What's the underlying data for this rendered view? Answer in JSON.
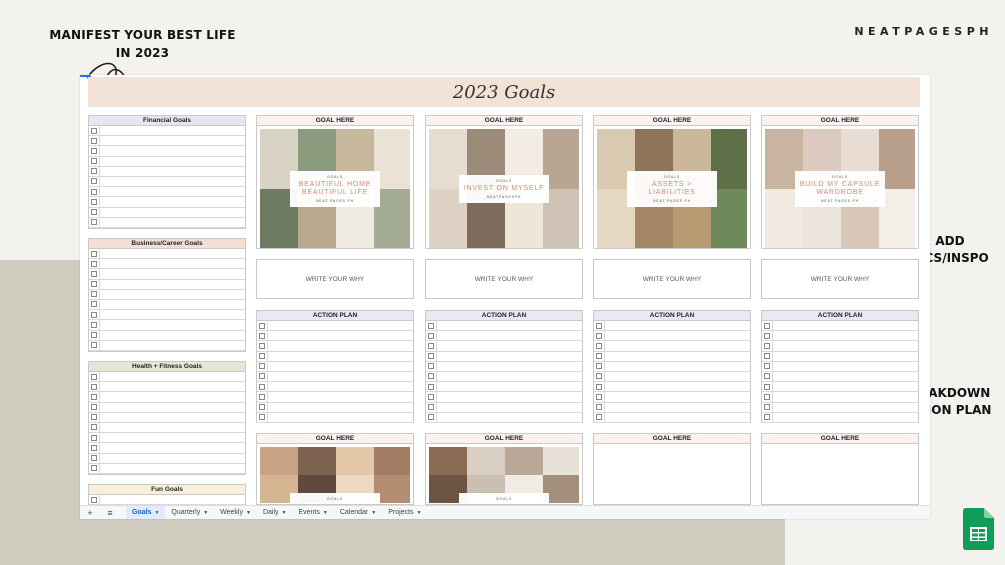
{
  "page": {
    "headline": "MANIFEST YOUR BEST LIFE IN 2023",
    "brand": "NEATPAGESPH",
    "add_pics_label": "ADD PICS/INSPO",
    "breakdown_label": "BREAKDOWN ACTION PLAN"
  },
  "sheet": {
    "title": "2023 Goals",
    "left_lists": [
      {
        "title": "Financial Goals",
        "color": "#e8e4f2"
      },
      {
        "title": "Business/Career Goals",
        "color": "#f3e0d4"
      },
      {
        "title": "Health + Fitness Goals",
        "color": "#e3e7d3"
      },
      {
        "title": "Fun Goals",
        "color": "#f7efd9"
      }
    ],
    "goal_header": "GOAL HERE",
    "why_text": "WRITE YOUR WHY",
    "action_plan_header": "ACTION PLAN",
    "goal_cards": [
      {
        "small": "GOALS",
        "title": "BEAUTIFUL HOME BEAUTIFUL LIFE",
        "credit": "NEAT PAGES PH"
      },
      {
        "small": "GOALS",
        "title": "INVEST ON MYSELF",
        "credit": "NEATPAGESPH"
      },
      {
        "small": "GOALS",
        "title": "ASSETS > LIABILITIES",
        "credit": "NEAT PAGES PH"
      },
      {
        "small": "GOALS",
        "title": "BUILD MY CAPSULE WARDROBE",
        "credit": "NEAT PAGES PH"
      }
    ],
    "bottom_cards": [
      {
        "small": "GOALS"
      },
      {
        "small": "GOALS"
      }
    ],
    "tabs": [
      {
        "label": "Goals",
        "active": true
      },
      {
        "label": "Quarterly",
        "active": false
      },
      {
        "label": "Weekly",
        "active": false
      },
      {
        "label": "Daily",
        "active": false
      },
      {
        "label": "Events",
        "active": false
      },
      {
        "label": "Calendar",
        "active": false
      },
      {
        "label": "Projects",
        "active": false
      }
    ]
  },
  "colors": {
    "background": "#f4f2ee",
    "bg_block": "#cfccbf",
    "title_bar": "#f3e3d6",
    "accent_pink": "#d4877a",
    "sheets_green": "#0f9d58"
  }
}
